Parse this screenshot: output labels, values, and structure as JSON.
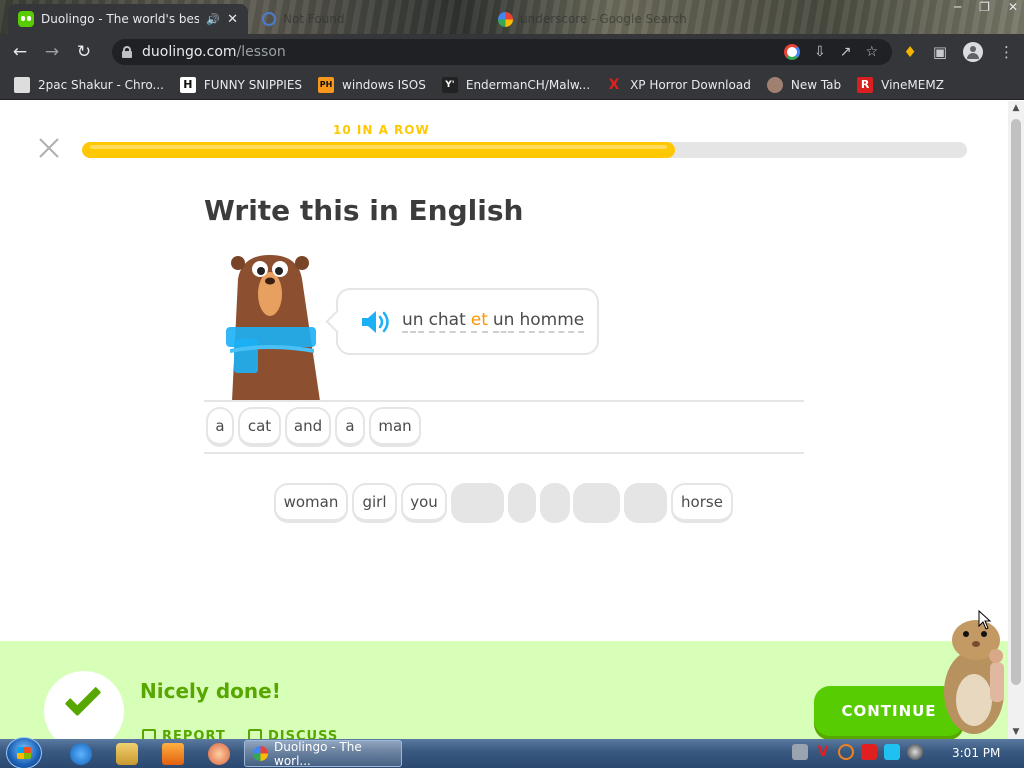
{
  "browser": {
    "tabs": [
      {
        "title": "Duolingo - The world's best",
        "active": true
      },
      {
        "title": "Not Found",
        "active": false
      },
      {
        "title": "underscore - Google Search",
        "active": false
      }
    ],
    "url_host": "duolingo.com",
    "url_path": "/lesson",
    "bookmarks": [
      {
        "label": "2pac Shakur - Chro...",
        "icon": "bookmark-icon",
        "color": "#e9e9e9"
      },
      {
        "label": "FUNNY SNIPPIES",
        "icon": "h-icon",
        "glyph": "H",
        "color": "#ffffff"
      },
      {
        "label": "windows ISOS",
        "icon": "ph-icon",
        "glyph": "PH",
        "color": "#f7971d"
      },
      {
        "label": "EndermanCH/Malw...",
        "icon": "yp-icon",
        "glyph": "Y'",
        "color": "#222222"
      },
      {
        "label": "XP Horror Download",
        "icon": "x-icon",
        "glyph": "X",
        "color": "#e02020"
      },
      {
        "label": "New Tab",
        "icon": "ball-icon",
        "color": "#a08070"
      },
      {
        "label": "VineMEMZ",
        "icon": "r-icon",
        "glyph": "R",
        "color": "#d82020"
      }
    ]
  },
  "lesson": {
    "streak_label": "10 IN A ROW",
    "progress": 0.67,
    "heading": "Write this in English",
    "prompt_words": [
      {
        "text": "un",
        "new": false
      },
      {
        "text": "chat",
        "new": false
      },
      {
        "text": "et",
        "new": true
      },
      {
        "text": "un",
        "new": false
      },
      {
        "text": "homme",
        "new": false
      }
    ],
    "answer_tiles": [
      "a",
      "cat",
      "and",
      "a",
      "man"
    ],
    "word_bank": [
      {
        "text": "woman",
        "used": false
      },
      {
        "text": "girl",
        "used": false
      },
      {
        "text": "you",
        "used": false
      },
      {
        "text": "",
        "used": true
      },
      {
        "text": "",
        "used": true
      },
      {
        "text": "",
        "used": true
      },
      {
        "text": "",
        "used": true
      },
      {
        "text": "",
        "used": true
      },
      {
        "text": "horse",
        "used": false
      }
    ]
  },
  "feedback": {
    "message": "Nicely done!",
    "report_label": "REPORT",
    "discuss_label": "DISCUSS",
    "continue_label": "CONTINUE"
  },
  "taskbar": {
    "task_title": "Duolingo - The worl...",
    "clock": "3:01 PM"
  },
  "colors": {
    "brand_green": "#58cc02",
    "feedback_bg": "#d7ffb8",
    "streak_yellow": "#ffc800",
    "new_word_orange": "#ff9600"
  }
}
